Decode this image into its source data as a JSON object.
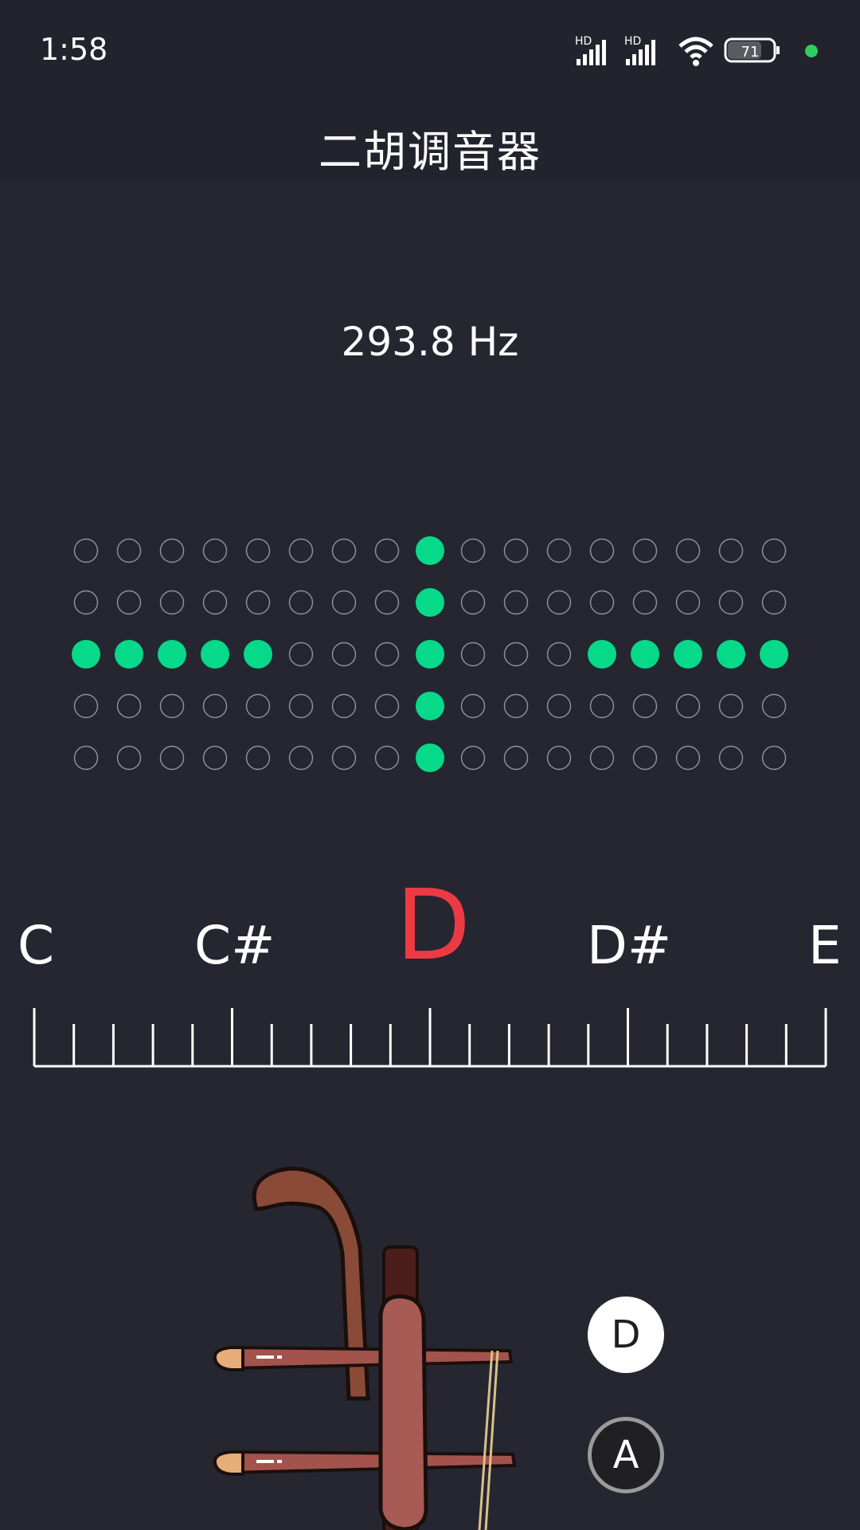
{
  "status_bar": {
    "time": "1:58",
    "battery": "71",
    "net_label_1": "HD",
    "net_label_2": "HD"
  },
  "app": {
    "title": "二胡调音器"
  },
  "tuner": {
    "frequency": "293.8 Hz",
    "dot_rows": [
      [
        0,
        0,
        0,
        0,
        0,
        0,
        0,
        0,
        1,
        0,
        0,
        0,
        0,
        0,
        0,
        0,
        0
      ],
      [
        0,
        0,
        0,
        0,
        0,
        0,
        0,
        0,
        1,
        0,
        0,
        0,
        0,
        0,
        0,
        0,
        0
      ],
      [
        1,
        1,
        1,
        1,
        1,
        0,
        0,
        0,
        1,
        0,
        0,
        0,
        1,
        1,
        1,
        1,
        1
      ],
      [
        0,
        0,
        0,
        0,
        0,
        0,
        0,
        0,
        1,
        0,
        0,
        0,
        0,
        0,
        0,
        0,
        0
      ],
      [
        0,
        0,
        0,
        0,
        0,
        0,
        0,
        0,
        1,
        0,
        0,
        0,
        0,
        0,
        0,
        0,
        0
      ]
    ],
    "notes": {
      "c": "C",
      "c_sharp": "C#",
      "current": "D",
      "d_sharp": "D#",
      "e": "E"
    }
  },
  "strings": {
    "d_label": "D",
    "a_label": "A",
    "selected": "D"
  },
  "colors": {
    "accent": "#06d98a",
    "note_current": "#ec3a45",
    "background": "#262631",
    "header": "#23232d"
  },
  "icons": [
    "signal-icon",
    "wifi-icon",
    "battery-icon",
    "status-dot-icon",
    "erhu-illustration"
  ]
}
